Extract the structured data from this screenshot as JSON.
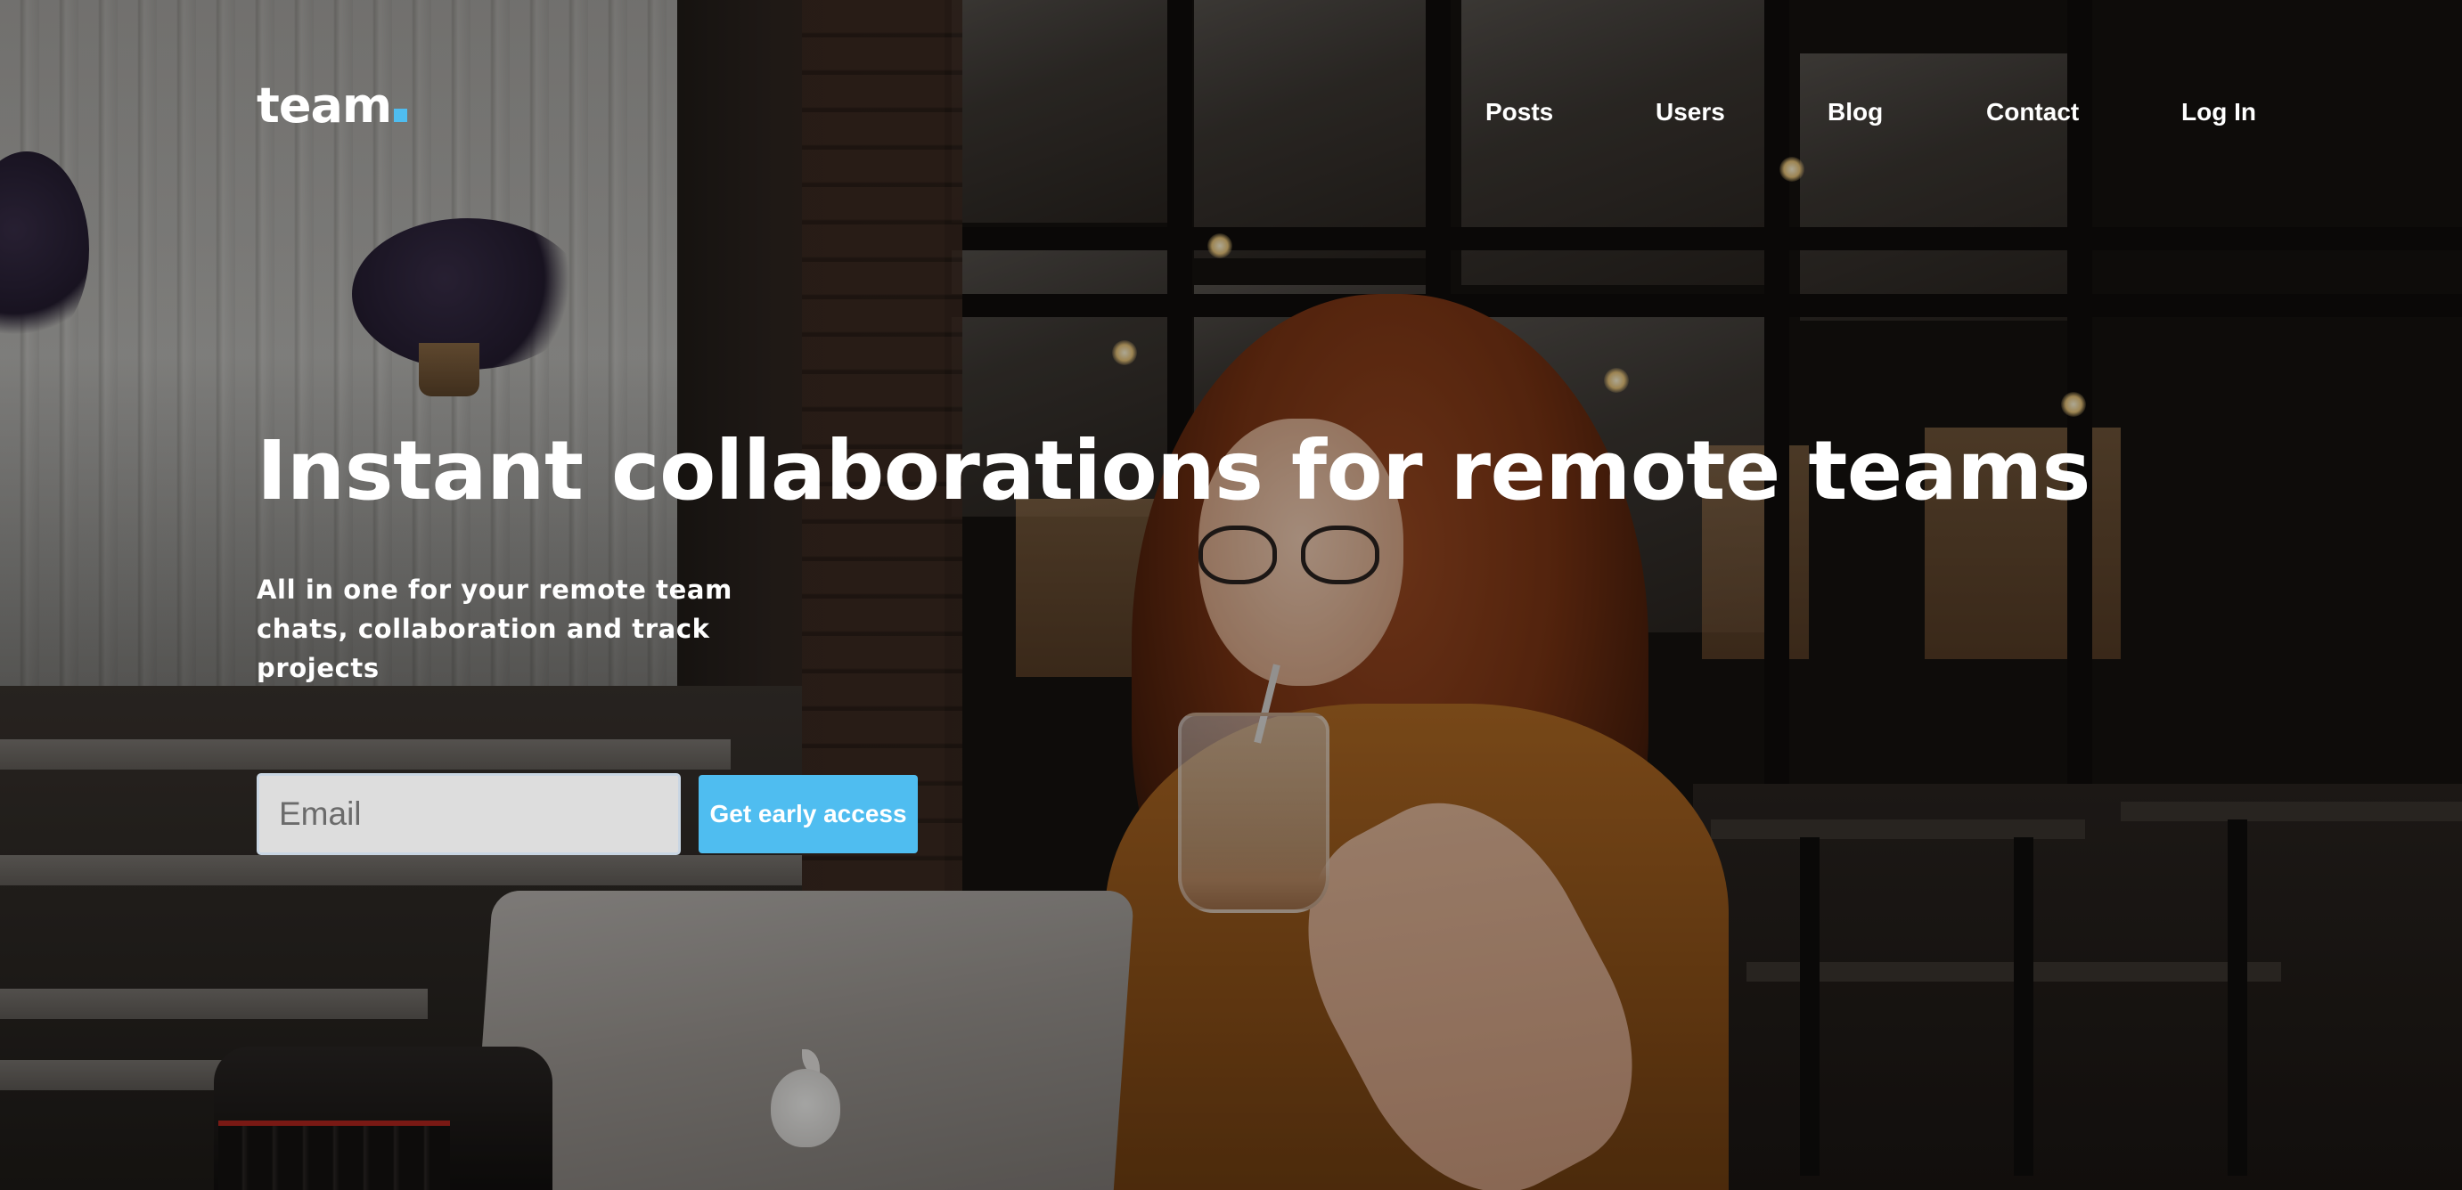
{
  "brand": {
    "name": "team",
    "accent_color": "#4fbdf0"
  },
  "nav": {
    "items": [
      {
        "label": "Posts"
      },
      {
        "label": "Users"
      },
      {
        "label": "Blog"
      },
      {
        "label": "Contact"
      },
      {
        "label": "Log In"
      }
    ]
  },
  "hero": {
    "headline": "Instant collaborations for remote teams",
    "subtext": "All in one for your remote team chats, collaboration and track projects",
    "email_placeholder": "Email",
    "cta_label": "Get early access",
    "cta_color": "#4fbdf0"
  }
}
